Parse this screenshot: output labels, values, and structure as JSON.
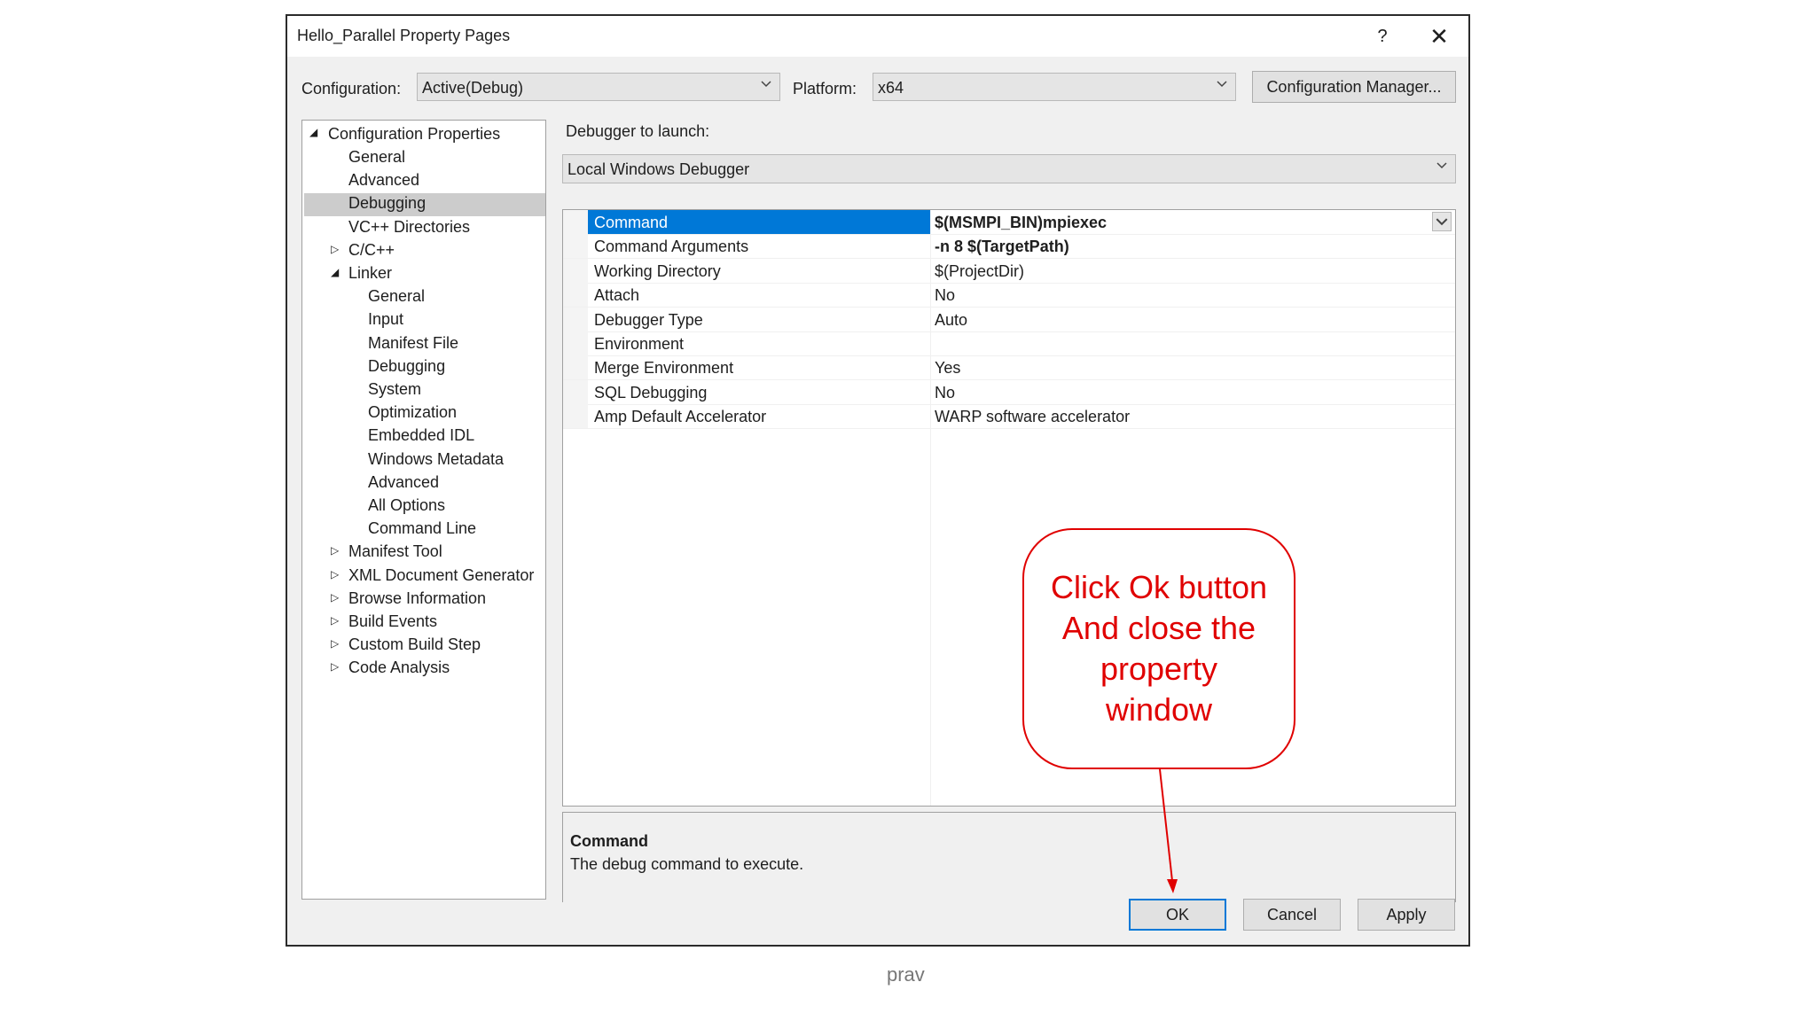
{
  "window": {
    "title": "Hello_Parallel Property Pages",
    "help_label": "?",
    "close_label": "✕"
  },
  "toolbar": {
    "configuration_label": "Configuration:",
    "configuration_value": "Active(Debug)",
    "platform_label": "Platform:",
    "platform_value": "x64",
    "config_manager_label": "Configuration Manager..."
  },
  "tree": {
    "root": "Configuration Properties",
    "items": [
      "General",
      "Advanced",
      "Debugging",
      "VC++ Directories",
      "C/C++",
      "Linker",
      "General",
      "Input",
      "Manifest File",
      "Debugging",
      "System",
      "Optimization",
      "Embedded IDL",
      "Windows Metadata",
      "Advanced",
      "All Options",
      "Command Line",
      "Manifest Tool",
      "XML Document Generator",
      "Browse Information",
      "Build Events",
      "Custom Build Step",
      "Code Analysis"
    ],
    "selected": "Debugging"
  },
  "debugger": {
    "launch_label": "Debugger to launch:",
    "launch_value": "Local Windows Debugger"
  },
  "properties": [
    {
      "name": "Command",
      "value": "$(MSMPI_BIN)mpiexec"
    },
    {
      "name": "Command Arguments",
      "value": "-n 8 $(TargetPath)"
    },
    {
      "name": "Working Directory",
      "value": "$(ProjectDir)"
    },
    {
      "name": "Attach",
      "value": "No"
    },
    {
      "name": "Debugger Type",
      "value": "Auto"
    },
    {
      "name": "Environment",
      "value": ""
    },
    {
      "name": "Merge Environment",
      "value": "Yes"
    },
    {
      "name": "SQL Debugging",
      "value": "No"
    },
    {
      "name": "Amp Default Accelerator",
      "value": "WARP software accelerator"
    }
  ],
  "description": {
    "title": "Command",
    "text": "The debug command to execute."
  },
  "buttons": {
    "ok": "OK",
    "cancel": "Cancel",
    "apply": "Apply"
  },
  "callout": {
    "text": "Click Ok button And close the property window"
  },
  "watermark": "prav",
  "colors": {
    "selection_blue": "#0078d7",
    "callout_red": "#e00000",
    "tree_selection": "#cccccc"
  }
}
